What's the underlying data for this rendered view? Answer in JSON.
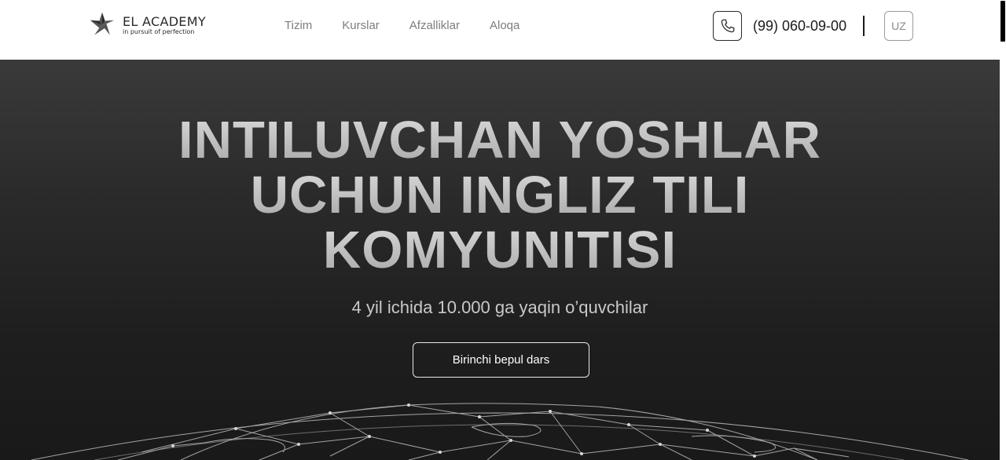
{
  "brand": {
    "name": "EL ACADEMY",
    "tagline": "in pursuit of perfection"
  },
  "nav": {
    "items": [
      "Tizim",
      "Kurslar",
      "Afzalliklar",
      "Aloqa"
    ]
  },
  "contact": {
    "phone": "(99) 060-09-00"
  },
  "language": {
    "current": "UZ"
  },
  "hero": {
    "title_lines": [
      "INTILUVCHAN YOSHLAR",
      "UCHUN INGLIZ TILI",
      "KOMYUNITISI"
    ],
    "subtitle": "4 yil ichida 10.000 ga yaqin o’quvchilar",
    "cta_label": "Birinchi bepul dars"
  },
  "icons": {
    "logo": "star-polygon-logo-icon",
    "phone": "phone-icon",
    "globe": "globe-network-icon"
  },
  "colors": {
    "header_bg": "#ffffff",
    "hero_bg": "#1c1c1c",
    "accent": "#ffffff"
  }
}
